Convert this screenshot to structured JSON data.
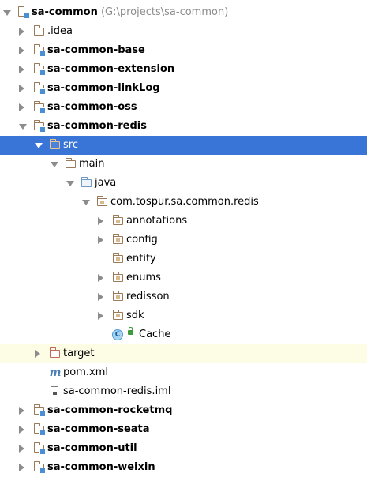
{
  "tree": {
    "root": {
      "label": "sa-common",
      "path": "(G:\\projects\\sa-common)"
    },
    "items": [
      {
        "label": ".idea",
        "depth": 1,
        "arrow": "col",
        "icon": "folder",
        "bold": false
      },
      {
        "label": "sa-common-base",
        "depth": 1,
        "arrow": "col",
        "icon": "module",
        "bold": true
      },
      {
        "label": "sa-common-extension",
        "depth": 1,
        "arrow": "col",
        "icon": "module",
        "bold": true
      },
      {
        "label": "sa-common-linkLog",
        "depth": 1,
        "arrow": "col",
        "icon": "module",
        "bold": true
      },
      {
        "label": "sa-common-oss",
        "depth": 1,
        "arrow": "col",
        "icon": "module",
        "bold": true
      },
      {
        "label": "sa-common-redis",
        "depth": 1,
        "arrow": "exp",
        "icon": "module",
        "bold": true
      },
      {
        "label": "src",
        "depth": 2,
        "arrow": "exp",
        "icon": "folder",
        "bold": false,
        "selected": true
      },
      {
        "label": "main",
        "depth": 3,
        "arrow": "exp",
        "icon": "folder",
        "bold": false
      },
      {
        "label": "java",
        "depth": 4,
        "arrow": "exp",
        "icon": "source-folder",
        "bold": false
      },
      {
        "label": "com.tospur.sa.common.redis",
        "depth": 5,
        "arrow": "exp",
        "icon": "package",
        "bold": false
      },
      {
        "label": "annotations",
        "depth": 6,
        "arrow": "col",
        "icon": "package",
        "bold": false
      },
      {
        "label": "config",
        "depth": 6,
        "arrow": "col",
        "icon": "package",
        "bold": false
      },
      {
        "label": "entity",
        "depth": 6,
        "arrow": "none",
        "icon": "package",
        "bold": false
      },
      {
        "label": "enums",
        "depth": 6,
        "arrow": "col",
        "icon": "package",
        "bold": false
      },
      {
        "label": "redisson",
        "depth": 6,
        "arrow": "col",
        "icon": "package",
        "bold": false
      },
      {
        "label": "sdk",
        "depth": 6,
        "arrow": "col",
        "icon": "package",
        "bold": false
      },
      {
        "label": "Cache",
        "depth": 6,
        "arrow": "none",
        "icon": "class",
        "bold": false
      },
      {
        "label": "target",
        "depth": 2,
        "arrow": "col",
        "icon": "excluded-folder",
        "bold": false,
        "highlight": true
      },
      {
        "label": "pom.xml",
        "depth": 2,
        "arrow": "none",
        "icon": "maven",
        "bold": false
      },
      {
        "label": "sa-common-redis.iml",
        "depth": 2,
        "arrow": "none",
        "icon": "iml-file",
        "bold": false
      },
      {
        "label": "sa-common-rocketmq",
        "depth": 1,
        "arrow": "col",
        "icon": "module",
        "bold": true
      },
      {
        "label": "sa-common-seata",
        "depth": 1,
        "arrow": "col",
        "icon": "module",
        "bold": true
      },
      {
        "label": "sa-common-util",
        "depth": 1,
        "arrow": "col",
        "icon": "module",
        "bold": true
      },
      {
        "label": "sa-common-weixin",
        "depth": 1,
        "arrow": "col",
        "icon": "module",
        "bold": true
      }
    ],
    "icons": {
      "maven": "m"
    },
    "colors": {
      "selection": "#3875d7",
      "highlight": "#fdfde6",
      "path": "#8c8c8c"
    }
  }
}
